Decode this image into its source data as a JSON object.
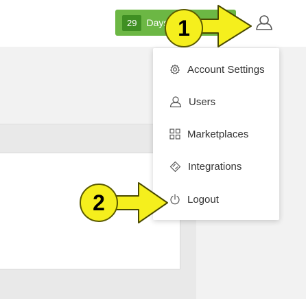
{
  "header": {
    "trial_count": "29",
    "trial_label": "Days"
  },
  "menu": {
    "items": [
      {
        "label": "Account Settings",
        "icon": "gear-icon"
      },
      {
        "label": "Users",
        "icon": "user-icon"
      },
      {
        "label": "Marketplaces",
        "icon": "grid-icon"
      },
      {
        "label": "Integrations",
        "icon": "puzzle-icon"
      },
      {
        "label": "Logout",
        "icon": "power-icon"
      }
    ]
  },
  "callouts": {
    "first": "1",
    "second": "2"
  },
  "colors": {
    "trial_green": "#6cb744",
    "callout_yellow": "#f5ef1d",
    "icon_gray": "#555555"
  }
}
